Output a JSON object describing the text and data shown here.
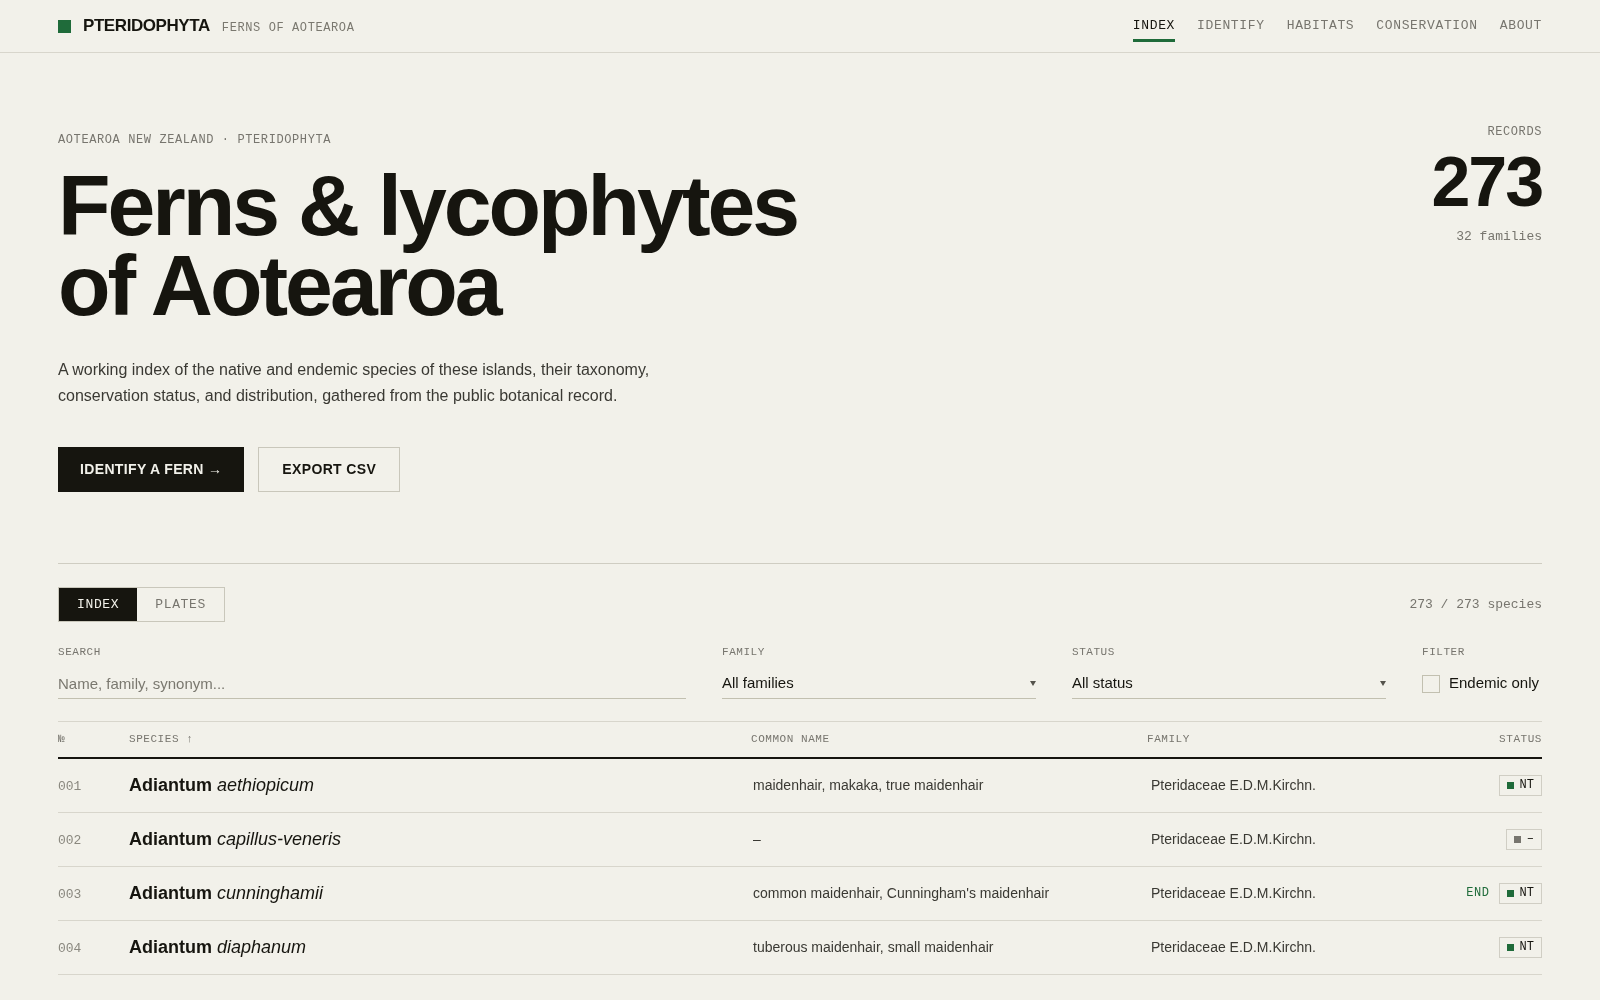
{
  "brand": {
    "name": "PTERIDOPHYTA",
    "tagline": "FERNS OF AOTEAROA"
  },
  "nav": [
    {
      "label": "INDEX",
      "selected": true
    },
    {
      "label": "IDENTIFY",
      "selected": false
    },
    {
      "label": "HABITATS",
      "selected": false
    },
    {
      "label": "CONSERVATION",
      "selected": false
    },
    {
      "label": "ABOUT",
      "selected": false
    }
  ],
  "hero": {
    "eyebrow": "AOTEAROA NEW ZEALAND · PTERIDOPHYTA",
    "title_lines": [
      "Ferns & lycophytes",
      "of Aotearoa"
    ],
    "description": "A working index of the native and endemic species of these islands, their taxonomy, conservation status, and distribution, gathered from the public botanical record.",
    "primary_button": "IDENTIFY A FERN →",
    "secondary_button": "EXPORT CSV"
  },
  "stats": {
    "label": "RECORDS",
    "value": "273",
    "sub": "32 families"
  },
  "view_tabs": [
    {
      "label": "INDEX",
      "selected": true
    },
    {
      "label": "PLATES",
      "selected": false
    }
  ],
  "count": "273 / 273 species",
  "filters": {
    "search": {
      "label": "SEARCH",
      "placeholder": "Name, family, synonym..."
    },
    "family": {
      "label": "FAMILY",
      "value": "All families"
    },
    "status": {
      "label": "STATUS",
      "value": "All status"
    },
    "endemic": {
      "label": "FILTER",
      "text": "Endemic only",
      "checked": false
    }
  },
  "table": {
    "columns": [
      "№",
      "SPECIES ↑",
      "COMMON NAME",
      "FAMILY",
      "STATUS"
    ],
    "rows": [
      {
        "no": "001",
        "genus": "Adiantum",
        "epithet": "aethiopicum",
        "common": "maidenhair, makaka, true maidenhair",
        "family": "Pteridaceae E.D.M.Kirchn.",
        "endemic": false,
        "status": "NT",
        "color": "#1f6b3a"
      },
      {
        "no": "002",
        "genus": "Adiantum",
        "epithet": "capillus-veneris",
        "common": "–",
        "family": "Pteridaceae E.D.M.Kirchn.",
        "endemic": false,
        "status": "–",
        "color": "#77756e"
      },
      {
        "no": "003",
        "genus": "Adiantum",
        "epithet": "cunninghamii",
        "common": "common maidenhair, Cunningham's maidenhair",
        "family": "Pteridaceae E.D.M.Kirchn.",
        "endemic": true,
        "endemic_label": "END",
        "status": "NT",
        "color": "#1f6b3a"
      },
      {
        "no": "004",
        "genus": "Adiantum",
        "epithet": "diaphanum",
        "common": "tuberous maidenhair, small maidenhair",
        "family": "Pteridaceae E.D.M.Kirchn.",
        "endemic": false,
        "status": "NT",
        "color": "#1f6b3a"
      }
    ]
  }
}
